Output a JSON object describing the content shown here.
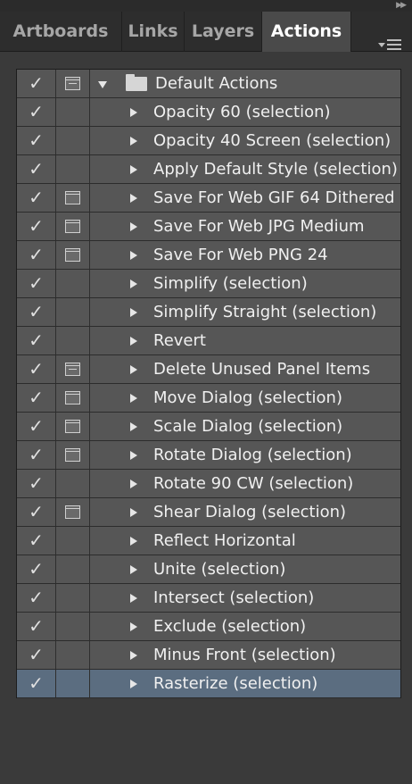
{
  "panel": {
    "tabs": [
      {
        "label": "Artboards",
        "active": false
      },
      {
        "label": "Links",
        "active": false
      },
      {
        "label": "Layers",
        "active": false
      },
      {
        "label": "Actions",
        "active": true
      }
    ],
    "collapse_icon": "double-chevron-right-icon",
    "menu_icon": "panel-menu-icon"
  },
  "actions": {
    "check_glyph": "✓",
    "set": {
      "name": "Default Actions",
      "expanded": true,
      "checked": true,
      "dialog": "partial"
    },
    "items": [
      {
        "name": "Opacity 60 (selection)",
        "checked": true,
        "dialog": false
      },
      {
        "name": "Opacity 40 Screen (selection)",
        "checked": true,
        "dialog": false
      },
      {
        "name": "Apply Default Style (selection)",
        "checked": true,
        "dialog": false
      },
      {
        "name": "Save For Web GIF 64 Dithered",
        "checked": true,
        "dialog": true
      },
      {
        "name": "Save For Web JPG Medium",
        "checked": true,
        "dialog": true
      },
      {
        "name": "Save For Web PNG 24",
        "checked": true,
        "dialog": true
      },
      {
        "name": "Simplify (selection)",
        "checked": true,
        "dialog": false
      },
      {
        "name": "Simplify Straight (selection)",
        "checked": true,
        "dialog": false
      },
      {
        "name": "Revert",
        "checked": true,
        "dialog": false
      },
      {
        "name": "Delete Unused Panel Items",
        "checked": true,
        "dialog": "partial"
      },
      {
        "name": "Move Dialog (selection)",
        "checked": true,
        "dialog": true
      },
      {
        "name": "Scale Dialog (selection)",
        "checked": true,
        "dialog": true
      },
      {
        "name": "Rotate Dialog (selection)",
        "checked": true,
        "dialog": true
      },
      {
        "name": "Rotate 90 CW (selection)",
        "checked": true,
        "dialog": false
      },
      {
        "name": "Shear Dialog (selection)",
        "checked": true,
        "dialog": true
      },
      {
        "name": "Reflect Horizontal",
        "checked": true,
        "dialog": false
      },
      {
        "name": "Unite (selection)",
        "checked": true,
        "dialog": false
      },
      {
        "name": "Intersect (selection)",
        "checked": true,
        "dialog": false
      },
      {
        "name": "Exclude (selection)",
        "checked": true,
        "dialog": false
      },
      {
        "name": "Minus Front (selection)",
        "checked": true,
        "dialog": false
      },
      {
        "name": "Rasterize (selection)",
        "checked": true,
        "dialog": false,
        "selected": true
      }
    ]
  },
  "colors": {
    "panel_bg": "#3a3a3a",
    "row_bg": "#565656",
    "selected_row_bg": "#5b6d80",
    "active_tab_bg": "#4a4a4a"
  }
}
